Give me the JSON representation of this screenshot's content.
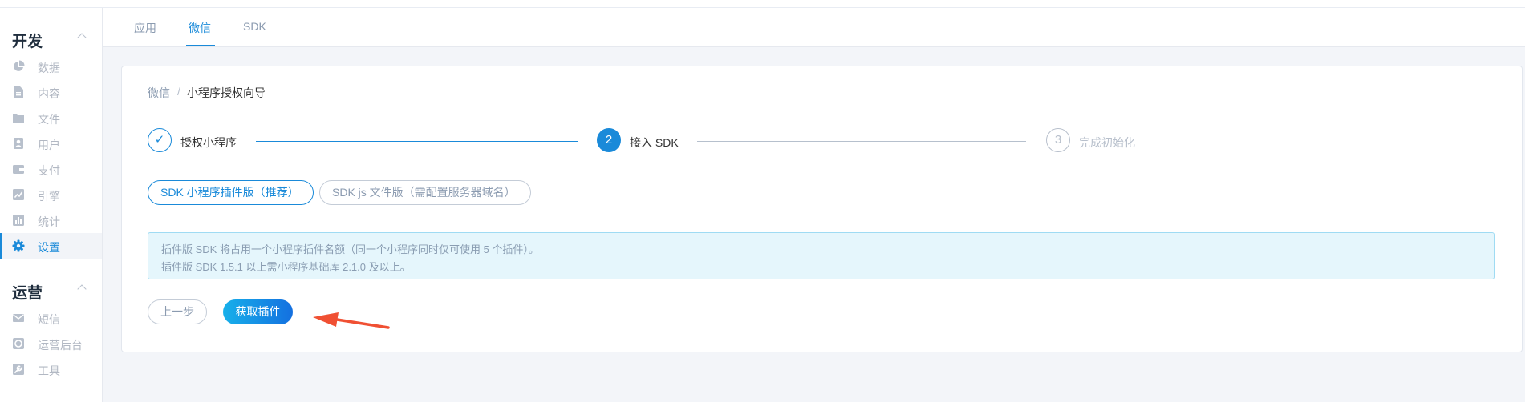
{
  "colors": {
    "primary": "#1a8ad9",
    "annotation_arrow": "#f05033",
    "notice_bg": "#e5f6fc"
  },
  "sidebar": {
    "groups": [
      {
        "title": "开发",
        "items": [
          {
            "label": "数据",
            "icon": "pie-chart-icon"
          },
          {
            "label": "内容",
            "icon": "document-icon"
          },
          {
            "label": "文件",
            "icon": "folder-icon"
          },
          {
            "label": "用户",
            "icon": "user-card-icon"
          },
          {
            "label": "支付",
            "icon": "wallet-icon"
          },
          {
            "label": "引擎",
            "icon": "trend-chart-icon"
          },
          {
            "label": "统计",
            "icon": "bar-chart-icon"
          },
          {
            "label": "设置",
            "icon": "gear-icon",
            "active": true
          }
        ]
      },
      {
        "title": "运营",
        "items": [
          {
            "label": "短信",
            "icon": "mail-icon"
          },
          {
            "label": "运营后台",
            "icon": "console-icon"
          },
          {
            "label": "工具",
            "icon": "wrench-icon"
          }
        ]
      }
    ]
  },
  "tabs": [
    {
      "label": "应用"
    },
    {
      "label": "微信",
      "active": true
    },
    {
      "label": "SDK"
    }
  ],
  "breadcrumb": {
    "parent": "微信",
    "separator": "/",
    "current": "小程序授权向导"
  },
  "steps": [
    {
      "marker": "✓",
      "label": "授权小程序",
      "status": "done"
    },
    {
      "marker": "2",
      "label": "接入 SDK",
      "status": "current"
    },
    {
      "marker": "3",
      "label": "完成初始化",
      "status": "pending"
    }
  ],
  "options": [
    {
      "label": "SDK 小程序插件版（推荐）",
      "selected": true
    },
    {
      "label": "SDK js 文件版（需配置服务器域名）",
      "selected": false
    }
  ],
  "notice": {
    "lines": [
      "插件版 SDK 将占用一个小程序插件名额（同一个小程序同时仅可使用 5 个插件）。",
      "插件版 SDK 1.5.1 以上需小程序基础库 2.1.0 及以上。"
    ]
  },
  "buttons": {
    "prev": "上一步",
    "get_plugin": "获取插件"
  }
}
